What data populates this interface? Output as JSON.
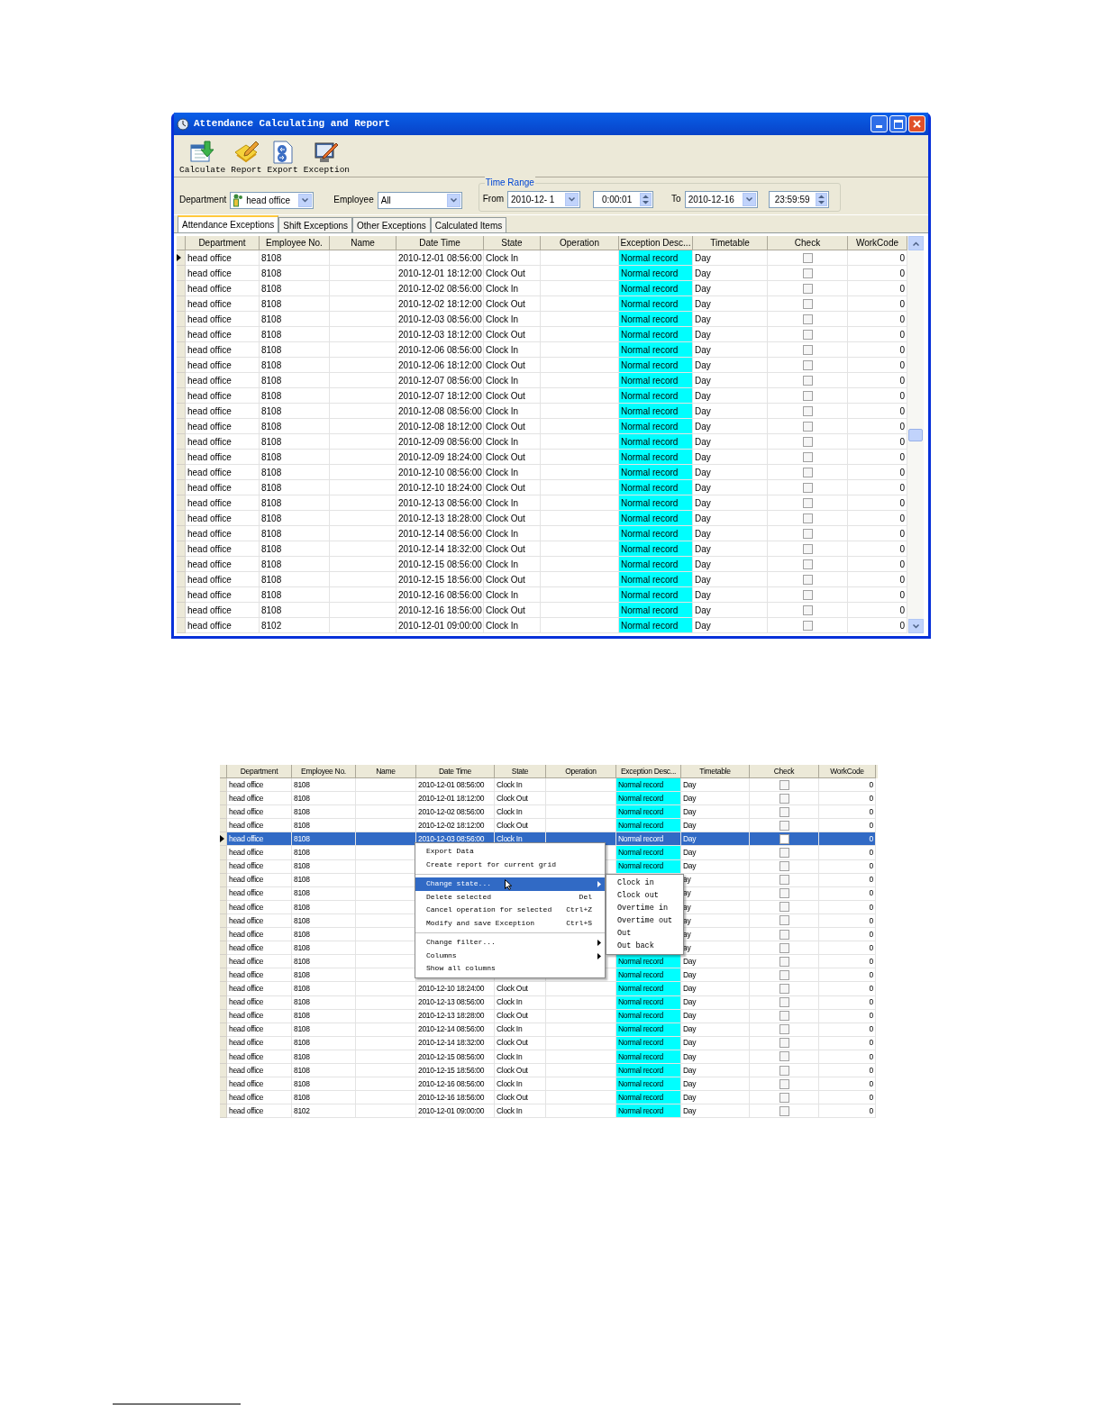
{
  "attendance_window": {
    "title": "Attendance Calculating and Report",
    "toolbar": [
      {
        "label": "Calculate",
        "kind": "calculate"
      },
      {
        "label": "Report",
        "kind": "report"
      },
      {
        "label": "Export",
        "kind": "export"
      },
      {
        "label": "Exception",
        "kind": "exception"
      }
    ],
    "department": {
      "label": "Department",
      "value": "head office"
    },
    "employee": {
      "label": "Employee",
      "value": "All"
    },
    "time_range": {
      "title": "Time Range",
      "from_label": "From",
      "from_date": "2010-12- 1",
      "from_time": "0:00:01",
      "to_label": "To",
      "to_date": "2010-12-16",
      "to_time": "23:59:59"
    },
    "tabs": [
      {
        "label": "Attendance Exceptions",
        "selected": true
      },
      {
        "label": "Shift Exceptions",
        "selected": false
      },
      {
        "label": "Other Exceptions",
        "selected": false
      },
      {
        "label": "Calculated Items",
        "selected": false
      }
    ],
    "grid": {
      "columns": [
        "Department",
        "Employee No.",
        "Name",
        "Date Time",
        "State",
        "Operation",
        "Exception Desc...",
        "Timetable",
        "Check",
        "WorkCode"
      ],
      "rows": [
        {
          "department": "head office",
          "employee_no": "8108",
          "date_time": "2010-12-01 08:56:00",
          "state": "Clock In",
          "exception": "Normal record",
          "timetable": "Day",
          "checked": false,
          "workcode": "0",
          "current": true
        },
        {
          "department": "head office",
          "employee_no": "8108",
          "date_time": "2010-12-01 18:12:00",
          "state": "Clock Out",
          "exception": "Normal record",
          "timetable": "Day",
          "checked": false,
          "workcode": "0",
          "current": false
        },
        {
          "department": "head office",
          "employee_no": "8108",
          "date_time": "2010-12-02 08:56:00",
          "state": "Clock In",
          "exception": "Normal record",
          "timetable": "Day",
          "checked": false,
          "workcode": "0",
          "current": false
        },
        {
          "department": "head office",
          "employee_no": "8108",
          "date_time": "2010-12-02 18:12:00",
          "state": "Clock Out",
          "exception": "Normal record",
          "timetable": "Day",
          "checked": false,
          "workcode": "0",
          "current": false
        },
        {
          "department": "head office",
          "employee_no": "8108",
          "date_time": "2010-12-03 08:56:00",
          "state": "Clock In",
          "exception": "Normal record",
          "timetable": "Day",
          "checked": false,
          "workcode": "0",
          "current": false
        },
        {
          "department": "head office",
          "employee_no": "8108",
          "date_time": "2010-12-03 18:12:00",
          "state": "Clock Out",
          "exception": "Normal record",
          "timetable": "Day",
          "checked": false,
          "workcode": "0",
          "current": false
        },
        {
          "department": "head office",
          "employee_no": "8108",
          "date_time": "2010-12-06 08:56:00",
          "state": "Clock In",
          "exception": "Normal record",
          "timetable": "Day",
          "checked": false,
          "workcode": "0",
          "current": false
        },
        {
          "department": "head office",
          "employee_no": "8108",
          "date_time": "2010-12-06 18:12:00",
          "state": "Clock Out",
          "exception": "Normal record",
          "timetable": "Day",
          "checked": false,
          "workcode": "0",
          "current": false
        },
        {
          "department": "head office",
          "employee_no": "8108",
          "date_time": "2010-12-07 08:56:00",
          "state": "Clock In",
          "exception": "Normal record",
          "timetable": "Day",
          "checked": false,
          "workcode": "0",
          "current": false
        },
        {
          "department": "head office",
          "employee_no": "8108",
          "date_time": "2010-12-07 18:12:00",
          "state": "Clock Out",
          "exception": "Normal record",
          "timetable": "Day",
          "checked": false,
          "workcode": "0",
          "current": false
        },
        {
          "department": "head office",
          "employee_no": "8108",
          "date_time": "2010-12-08 08:56:00",
          "state": "Clock In",
          "exception": "Normal record",
          "timetable": "Day",
          "checked": false,
          "workcode": "0",
          "current": false
        },
        {
          "department": "head office",
          "employee_no": "8108",
          "date_time": "2010-12-08 18:12:00",
          "state": "Clock Out",
          "exception": "Normal record",
          "timetable": "Day",
          "checked": false,
          "workcode": "0",
          "current": false
        },
        {
          "department": "head office",
          "employee_no": "8108",
          "date_time": "2010-12-09 08:56:00",
          "state": "Clock In",
          "exception": "Normal record",
          "timetable": "Day",
          "checked": false,
          "workcode": "0",
          "current": false
        },
        {
          "department": "head office",
          "employee_no": "8108",
          "date_time": "2010-12-09 18:24:00",
          "state": "Clock Out",
          "exception": "Normal record",
          "timetable": "Day",
          "checked": false,
          "workcode": "0",
          "current": false
        },
        {
          "department": "head office",
          "employee_no": "8108",
          "date_time": "2010-12-10 08:56:00",
          "state": "Clock In",
          "exception": "Normal record",
          "timetable": "Day",
          "checked": false,
          "workcode": "0",
          "current": false
        },
        {
          "department": "head office",
          "employee_no": "8108",
          "date_time": "2010-12-10 18:24:00",
          "state": "Clock Out",
          "exception": "Normal record",
          "timetable": "Day",
          "checked": false,
          "workcode": "0",
          "current": false
        },
        {
          "department": "head office",
          "employee_no": "8108",
          "date_time": "2010-12-13 08:56:00",
          "state": "Clock In",
          "exception": "Normal record",
          "timetable": "Day",
          "checked": false,
          "workcode": "0",
          "current": false
        },
        {
          "department": "head office",
          "employee_no": "8108",
          "date_time": "2010-12-13 18:28:00",
          "state": "Clock Out",
          "exception": "Normal record",
          "timetable": "Day",
          "checked": false,
          "workcode": "0",
          "current": false
        },
        {
          "department": "head office",
          "employee_no": "8108",
          "date_time": "2010-12-14 08:56:00",
          "state": "Clock In",
          "exception": "Normal record",
          "timetable": "Day",
          "checked": false,
          "workcode": "0",
          "current": false
        },
        {
          "department": "head office",
          "employee_no": "8108",
          "date_time": "2010-12-14 18:32:00",
          "state": "Clock Out",
          "exception": "Normal record",
          "timetable": "Day",
          "checked": false,
          "workcode": "0",
          "current": false
        },
        {
          "department": "head office",
          "employee_no": "8108",
          "date_time": "2010-12-15 08:56:00",
          "state": "Clock In",
          "exception": "Normal record",
          "timetable": "Day",
          "checked": false,
          "workcode": "0",
          "current": false
        },
        {
          "department": "head office",
          "employee_no": "8108",
          "date_time": "2010-12-15 18:56:00",
          "state": "Clock Out",
          "exception": "Normal record",
          "timetable": "Day",
          "checked": false,
          "workcode": "0",
          "current": false
        },
        {
          "department": "head office",
          "employee_no": "8108",
          "date_time": "2010-12-16 08:56:00",
          "state": "Clock In",
          "exception": "Normal record",
          "timetable": "Day",
          "checked": false,
          "workcode": "0",
          "current": false
        },
        {
          "department": "head office",
          "employee_no": "8108",
          "date_time": "2010-12-16 18:56:00",
          "state": "Clock Out",
          "exception": "Normal record",
          "timetable": "Day",
          "checked": false,
          "workcode": "0",
          "current": false
        },
        {
          "department": "head office",
          "employee_no": "8102",
          "date_time": "2010-12-01 09:00:00",
          "state": "Clock In",
          "exception": "Normal record",
          "timetable": "Day",
          "checked": false,
          "workcode": "0",
          "current": false
        }
      ]
    }
  },
  "context_menu_screenshot": {
    "grid": {
      "columns": [
        "Department",
        "Employee No.",
        "Name",
        "Date Time",
        "State",
        "Operation",
        "Exception Desc...",
        "Timetable",
        "Check",
        "WorkCode"
      ],
      "rows": [
        {
          "department": "head office",
          "employee_no": "8108",
          "date_time": "2010-12-01 08:56:00",
          "state": "Clock In",
          "exception": "Normal record",
          "timetable": "Day",
          "checked": false,
          "workcode": "0",
          "selected": false
        },
        {
          "department": "head office",
          "employee_no": "8108",
          "date_time": "2010-12-01 18:12:00",
          "state": "Clock Out",
          "exception": "Normal record",
          "timetable": "Day",
          "checked": false,
          "workcode": "0",
          "selected": false
        },
        {
          "department": "head office",
          "employee_no": "8108",
          "date_time": "2010-12-02 08:56:00",
          "state": "Clock In",
          "exception": "Normal record",
          "timetable": "Day",
          "checked": false,
          "workcode": "0",
          "selected": false
        },
        {
          "department": "head office",
          "employee_no": "8108",
          "date_time": "2010-12-02 18:12:00",
          "state": "Clock Out",
          "exception": "Normal record",
          "timetable": "Day",
          "checked": false,
          "workcode": "0",
          "selected": false
        },
        {
          "department": "head office",
          "employee_no": "8108",
          "date_time": "2010-12-03 08:56:00",
          "state": "Clock In",
          "exception": "Normal record",
          "timetable": "Day",
          "checked": false,
          "workcode": "0",
          "selected": true
        },
        {
          "department": "head office",
          "employee_no": "8108",
          "exception": "Normal record",
          "timetable": "Day",
          "checked": false,
          "workcode": "0",
          "selected": false
        },
        {
          "department": "head office",
          "employee_no": "8108",
          "exception": "Normal record",
          "timetable": "Day",
          "checked": false,
          "workcode": "0",
          "selected": false
        },
        {
          "department": "head office",
          "employee_no": "8108",
          "timetable": "ay",
          "checked": false,
          "workcode": "0",
          "selected": false
        },
        {
          "department": "head office",
          "employee_no": "8108",
          "timetable": "ay",
          "checked": false,
          "workcode": "0",
          "selected": false
        },
        {
          "department": "head office",
          "employee_no": "8108",
          "timetable": "ay",
          "checked": false,
          "workcode": "0",
          "selected": false
        },
        {
          "department": "head office",
          "employee_no": "8108",
          "timetable": "ay",
          "checked": false,
          "workcode": "0",
          "selected": false
        },
        {
          "department": "head office",
          "employee_no": "8108",
          "timetable": "ay",
          "checked": false,
          "workcode": "0",
          "selected": false
        },
        {
          "department": "head office",
          "employee_no": "8108",
          "timetable": "ay",
          "checked": false,
          "workcode": "0",
          "selected": false
        },
        {
          "department": "head office",
          "employee_no": "8108",
          "exception": "Normal record",
          "timetable": "Day",
          "checked": false,
          "workcode": "0",
          "selected": false
        },
        {
          "department": "head office",
          "employee_no": "8108",
          "exception": "Normal record",
          "timetable": "Day",
          "checked": false,
          "workcode": "0",
          "selected": false
        },
        {
          "department": "head office",
          "employee_no": "8108",
          "date_time": "2010-12-10 18:24:00",
          "state": "Clock Out",
          "exception": "Normal record",
          "timetable": "Day",
          "checked": false,
          "workcode": "0",
          "selected": false
        },
        {
          "department": "head office",
          "employee_no": "8108",
          "date_time": "2010-12-13 08:56:00",
          "state": "Clock In",
          "exception": "Normal record",
          "timetable": "Day",
          "checked": false,
          "workcode": "0",
          "selected": false
        },
        {
          "department": "head office",
          "employee_no": "8108",
          "date_time": "2010-12-13 18:28:00",
          "state": "Clock Out",
          "exception": "Normal record",
          "timetable": "Day",
          "checked": false,
          "workcode": "0",
          "selected": false
        },
        {
          "department": "head office",
          "employee_no": "8108",
          "date_time": "2010-12-14 08:56:00",
          "state": "Clock In",
          "exception": "Normal record",
          "timetable": "Day",
          "checked": false,
          "workcode": "0",
          "selected": false
        },
        {
          "department": "head office",
          "employee_no": "8108",
          "date_time": "2010-12-14 18:32:00",
          "state": "Clock Out",
          "exception": "Normal record",
          "timetable": "Day",
          "checked": false,
          "workcode": "0",
          "selected": false
        },
        {
          "department": "head office",
          "employee_no": "8108",
          "date_time": "2010-12-15 08:56:00",
          "state": "Clock In",
          "exception": "Normal record",
          "timetable": "Day",
          "checked": false,
          "workcode": "0",
          "selected": false
        },
        {
          "department": "head office",
          "employee_no": "8108",
          "date_time": "2010-12-15 18:56:00",
          "state": "Clock Out",
          "exception": "Normal record",
          "timetable": "Day",
          "checked": false,
          "workcode": "0",
          "selected": false
        },
        {
          "department": "head office",
          "employee_no": "8108",
          "date_time": "2010-12-16 08:56:00",
          "state": "Clock In",
          "exception": "Normal record",
          "timetable": "Day",
          "checked": false,
          "workcode": "0",
          "selected": false
        },
        {
          "department": "head office",
          "employee_no": "8108",
          "date_time": "2010-12-16 18:56:00",
          "state": "Clock Out",
          "exception": "Normal record",
          "timetable": "Day",
          "checked": false,
          "workcode": "0",
          "selected": false
        },
        {
          "department": "head office",
          "employee_no": "8102",
          "date_time": "2010-12-01 09:00:00",
          "state": "Clock In",
          "exception": "Normal record",
          "timetable": "Day",
          "checked": false,
          "workcode": "0",
          "selected": false
        }
      ]
    },
    "context_menu": {
      "groups": [
        [
          {
            "label": "Export Data",
            "highlighted": false,
            "submenu": false
          },
          {
            "label": "Create report for current grid",
            "highlighted": false,
            "submenu": false
          }
        ],
        [
          {
            "label": "Change state...",
            "highlighted": true,
            "submenu": true
          },
          {
            "label": "Delete selected",
            "shortcut": "Del",
            "highlighted": false,
            "submenu": false
          },
          {
            "label": "Cancel operation for selected",
            "shortcut": "Ctrl+Z",
            "highlighted": false,
            "submenu": false
          },
          {
            "label": "Modify and save Exception",
            "shortcut": "Ctrl+S",
            "highlighted": false,
            "submenu": false
          }
        ],
        [
          {
            "label": "Change filter...",
            "highlighted": false,
            "submenu": true
          },
          {
            "label": "Columns",
            "highlighted": false,
            "submenu": true
          },
          {
            "label": "Show all columns",
            "highlighted": false,
            "submenu": false
          }
        ]
      ]
    },
    "submenu": {
      "items": [
        "Clock in",
        "Clock out",
        "Overtime in",
        "Overtime out",
        "Out",
        "Out back"
      ]
    }
  }
}
